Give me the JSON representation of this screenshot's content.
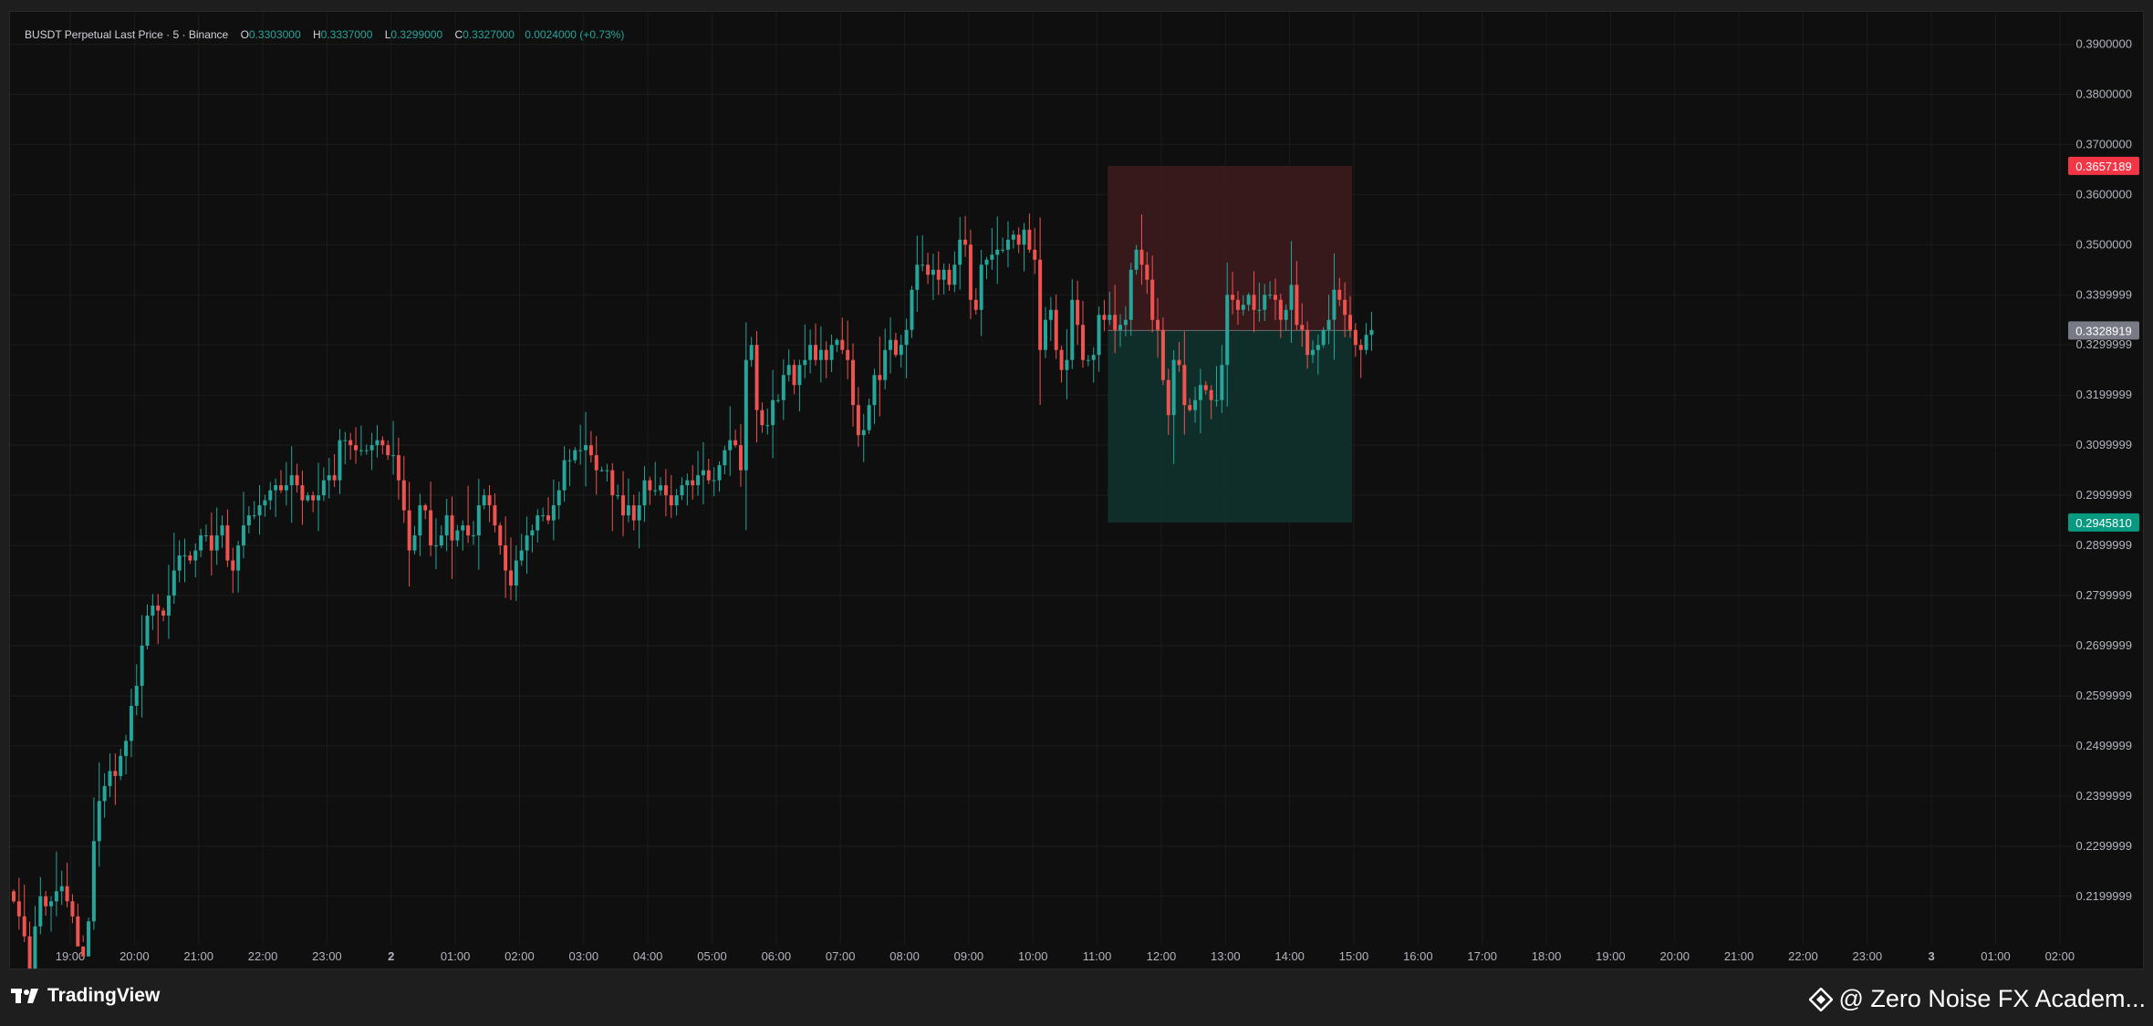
{
  "legend": {
    "symbol": "BUSDT Perpetual Last Price · 5 · Binance",
    "o_label": "O",
    "o_value": "0.3303000",
    "h_label": "H",
    "h_value": "0.3337000",
    "l_label": "L",
    "l_value": "0.3299000",
    "c_label": "C",
    "c_value": "0.3327000",
    "change": "0.0024000 (+0.73%)"
  },
  "footer": {
    "brand": "TradingView",
    "watermark": "@ Zero Noise FX Academ..."
  },
  "colors": {
    "up": "#26a69a",
    "down": "#ef5350",
    "background": "#0f0f0f",
    "grid": "#1c1c1c",
    "stop_zone": "#3a1a1d",
    "target_zone": "#11302b"
  },
  "chart_data": {
    "type": "candlestick",
    "y_axis": {
      "min": 0.2145,
      "max": 0.395,
      "ticks": [
        "0.3900000",
        "0.3800000",
        "0.3700000",
        "0.3600000",
        "0.3500000",
        "0.3399999",
        "0.3299999",
        "0.3199999",
        "0.3099999",
        "0.2999999",
        "0.2899999",
        "0.2799999",
        "0.2699999",
        "0.2599999",
        "0.2499999",
        "0.2399999",
        "0.2299999",
        "0.2199999"
      ]
    },
    "x_axis": {
      "ticks": [
        "19:00",
        "20:00",
        "21:00",
        "22:00",
        "23:00",
        "2",
        "01:00",
        "02:00",
        "03:00",
        "04:00",
        "05:00",
        "06:00",
        "07:00",
        "08:00",
        "09:00",
        "10:00",
        "11:00",
        "12:00",
        "13:00",
        "14:00",
        "15:00",
        "16:00",
        "17:00",
        "18:00",
        "19:00",
        "20:00",
        "21:00",
        "22:00",
        "23:00",
        "3",
        "01:00",
        "02:00"
      ]
    },
    "price_labels": {
      "stop": "0.3657189",
      "current": "0.3328919",
      "target": "0.2945810"
    },
    "position": {
      "type": "short",
      "start_time_offset_h": 0,
      "entry": 0.3328919,
      "stop": 0.3657189,
      "target": 0.294581,
      "from_candle": 205,
      "to_candle": 250
    },
    "closes": [
      0.219,
      0.216,
      0.212,
      0.205,
      0.214,
      0.22,
      0.218,
      0.219,
      0.221,
      0.222,
      0.219,
      0.216,
      0.21,
      0.208,
      0.215,
      0.231,
      0.239,
      0.242,
      0.245,
      0.244,
      0.248,
      0.251,
      0.258,
      0.262,
      0.27,
      0.276,
      0.278,
      0.277,
      0.276,
      0.28,
      0.285,
      0.288,
      0.288,
      0.287,
      0.289,
      0.292,
      0.292,
      0.289,
      0.292,
      0.294,
      0.287,
      0.285,
      0.29,
      0.294,
      0.296,
      0.296,
      0.298,
      0.299,
      0.301,
      0.302,
      0.301,
      0.302,
      0.304,
      0.302,
      0.299,
      0.3,
      0.299,
      0.3,
      0.303,
      0.304,
      0.303,
      0.311,
      0.311,
      0.31,
      0.309,
      0.309,
      0.309,
      0.31,
      0.311,
      0.31,
      0.308,
      0.308,
      0.303,
      0.297,
      0.289,
      0.292,
      0.298,
      0.297,
      0.29,
      0.29,
      0.292,
      0.296,
      0.291,
      0.293,
      0.294,
      0.292,
      0.292,
      0.298,
      0.3,
      0.298,
      0.294,
      0.29,
      0.285,
      0.282,
      0.287,
      0.289,
      0.292,
      0.293,
      0.296,
      0.296,
      0.295,
      0.298,
      0.301,
      0.307,
      0.307,
      0.309,
      0.309,
      0.31,
      0.308,
      0.305,
      0.305,
      0.305,
      0.3,
      0.3,
      0.296,
      0.298,
      0.295,
      0.298,
      0.303,
      0.301,
      0.301,
      0.302,
      0.3,
      0.298,
      0.3,
      0.302,
      0.303,
      0.302,
      0.304,
      0.305,
      0.303,
      0.303,
      0.306,
      0.309,
      0.311,
      0.31,
      0.305,
      0.327,
      0.33,
      0.317,
      0.314,
      0.314,
      0.319,
      0.319,
      0.324,
      0.326,
      0.322,
      0.326,
      0.327,
      0.33,
      0.327,
      0.329,
      0.327,
      0.33,
      0.331,
      0.329,
      0.327,
      0.318,
      0.312,
      0.313,
      0.318,
      0.324,
      0.323,
      0.329,
      0.331,
      0.328,
      0.33,
      0.333,
      0.341,
      0.346,
      0.346,
      0.344,
      0.345,
      0.343,
      0.345,
      0.342,
      0.346,
      0.351,
      0.35,
      0.339,
      0.337,
      0.346,
      0.347,
      0.348,
      0.349,
      0.349,
      0.351,
      0.352,
      0.35,
      0.353,
      0.349,
      0.347,
      0.329,
      0.335,
      0.337,
      0.329,
      0.325,
      0.327,
      0.339,
      0.334,
      0.327,
      0.327,
      0.328,
      0.336,
      0.335,
      0.336,
      0.333,
      0.334,
      0.335,
      0.345,
      0.349,
      0.346,
      0.343,
      0.335,
      0.333,
      0.323,
      0.316,
      0.327,
      0.326,
      0.318,
      0.317,
      0.319,
      0.322,
      0.321,
      0.319,
      0.319,
      0.326,
      0.34,
      0.339,
      0.337,
      0.338,
      0.34,
      0.337,
      0.337,
      0.34,
      0.34,
      0.339,
      0.335,
      0.337,
      0.342,
      0.334,
      0.333,
      0.328,
      0.329,
      0.33,
      0.333,
      0.335,
      0.341,
      0.339,
      0.336,
      0.333,
      0.33,
      0.329,
      0.332,
      0.333
    ]
  }
}
